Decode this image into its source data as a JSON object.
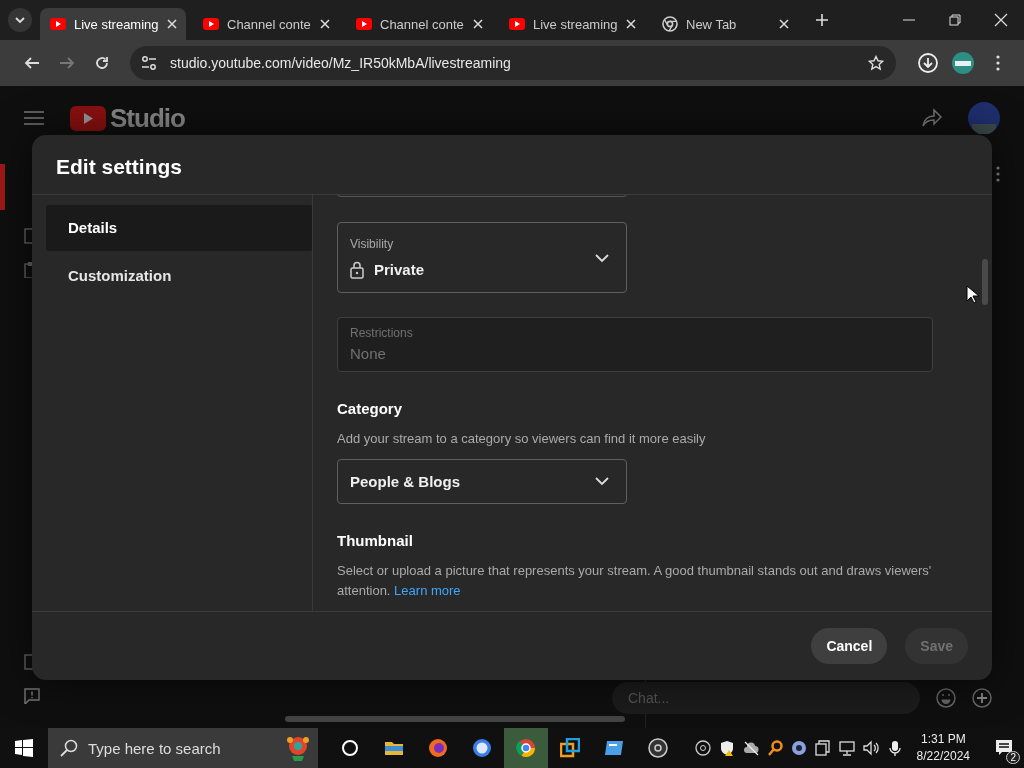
{
  "browser": {
    "tabs": [
      {
        "title": "Live streaming",
        "kind": "youtube",
        "selected": true
      },
      {
        "title": "Channel conte",
        "kind": "youtube",
        "selected": false
      },
      {
        "title": "Channel conte",
        "kind": "youtube",
        "selected": false
      },
      {
        "title": "Live streaming",
        "kind": "youtube",
        "selected": false
      },
      {
        "title": "New Tab",
        "kind": "chrome",
        "selected": false
      }
    ],
    "address": "studio.youtube.com/video/Mz_IR50kMbA/livestreaming"
  },
  "studio": {
    "logo_text": "Studio",
    "chat": {
      "placeholder": "Chat..."
    }
  },
  "dialog": {
    "title": "Edit settings",
    "nav": [
      {
        "label": "Details",
        "selected": true
      },
      {
        "label": "Customization",
        "selected": false
      }
    ],
    "visibility": {
      "label": "Visibility",
      "value": "Private"
    },
    "restrictions": {
      "label": "Restrictions",
      "value": "None",
      "disabled": true
    },
    "category": {
      "heading": "Category",
      "description": "Add your stream to a category so viewers can find it more easily",
      "value": "People & Blogs"
    },
    "thumbnail": {
      "heading": "Thumbnail",
      "description": "Select or upload a picture that represents your stream. A good thumbnail stands out and draws viewers' attention.",
      "link": "Learn more"
    },
    "buttons": [
      {
        "label": "Cancel",
        "disabled": false
      },
      {
        "label": "Save",
        "disabled": true
      }
    ]
  },
  "taskbar": {
    "search_placeholder": "Type here to search",
    "time": "1:31 PM",
    "date": "8/22/2024",
    "notifications": "2"
  }
}
